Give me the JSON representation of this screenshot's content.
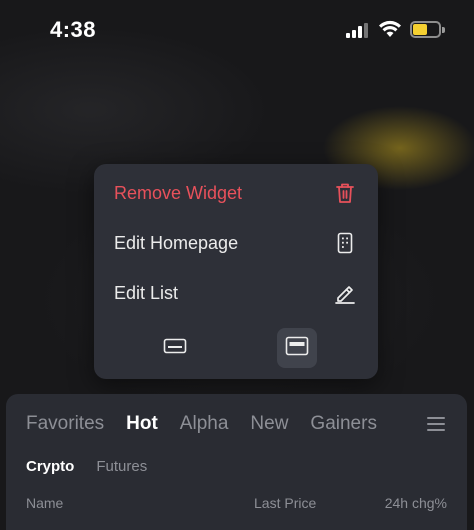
{
  "status_bar": {
    "time": "4:38",
    "battery_level_fraction": 0.55,
    "battery_color": "#f5d031"
  },
  "context_menu": {
    "items": [
      {
        "label": "Remove Widget",
        "icon": "trash-icon",
        "color": "#e8515b"
      },
      {
        "label": "Edit Homepage",
        "icon": "grid-phone-icon",
        "color": "#ececec"
      },
      {
        "label": "Edit List",
        "icon": "pencil-icon",
        "color": "#ececec"
      }
    ],
    "size_options": [
      {
        "icon": "small-widget-icon",
        "selected": false
      },
      {
        "icon": "large-widget-icon",
        "selected": true
      }
    ]
  },
  "market_panel": {
    "tabs": [
      {
        "label": "Favorites",
        "active": false
      },
      {
        "label": "Hot",
        "active": true
      },
      {
        "label": "Alpha",
        "active": false
      },
      {
        "label": "New",
        "active": false
      },
      {
        "label": "Gainers",
        "active": false
      }
    ],
    "menu_icon": "hamburger-icon",
    "subtabs": [
      {
        "label": "Crypto",
        "active": true
      },
      {
        "label": "Futures",
        "active": false
      }
    ],
    "columns": {
      "name": "Name",
      "last_price": "Last Price",
      "change": "24h chg%"
    }
  },
  "colors": {
    "accent_danger": "#e8515b",
    "menu_bg": "#2e3038",
    "panel_bg": "#2a2c33"
  }
}
